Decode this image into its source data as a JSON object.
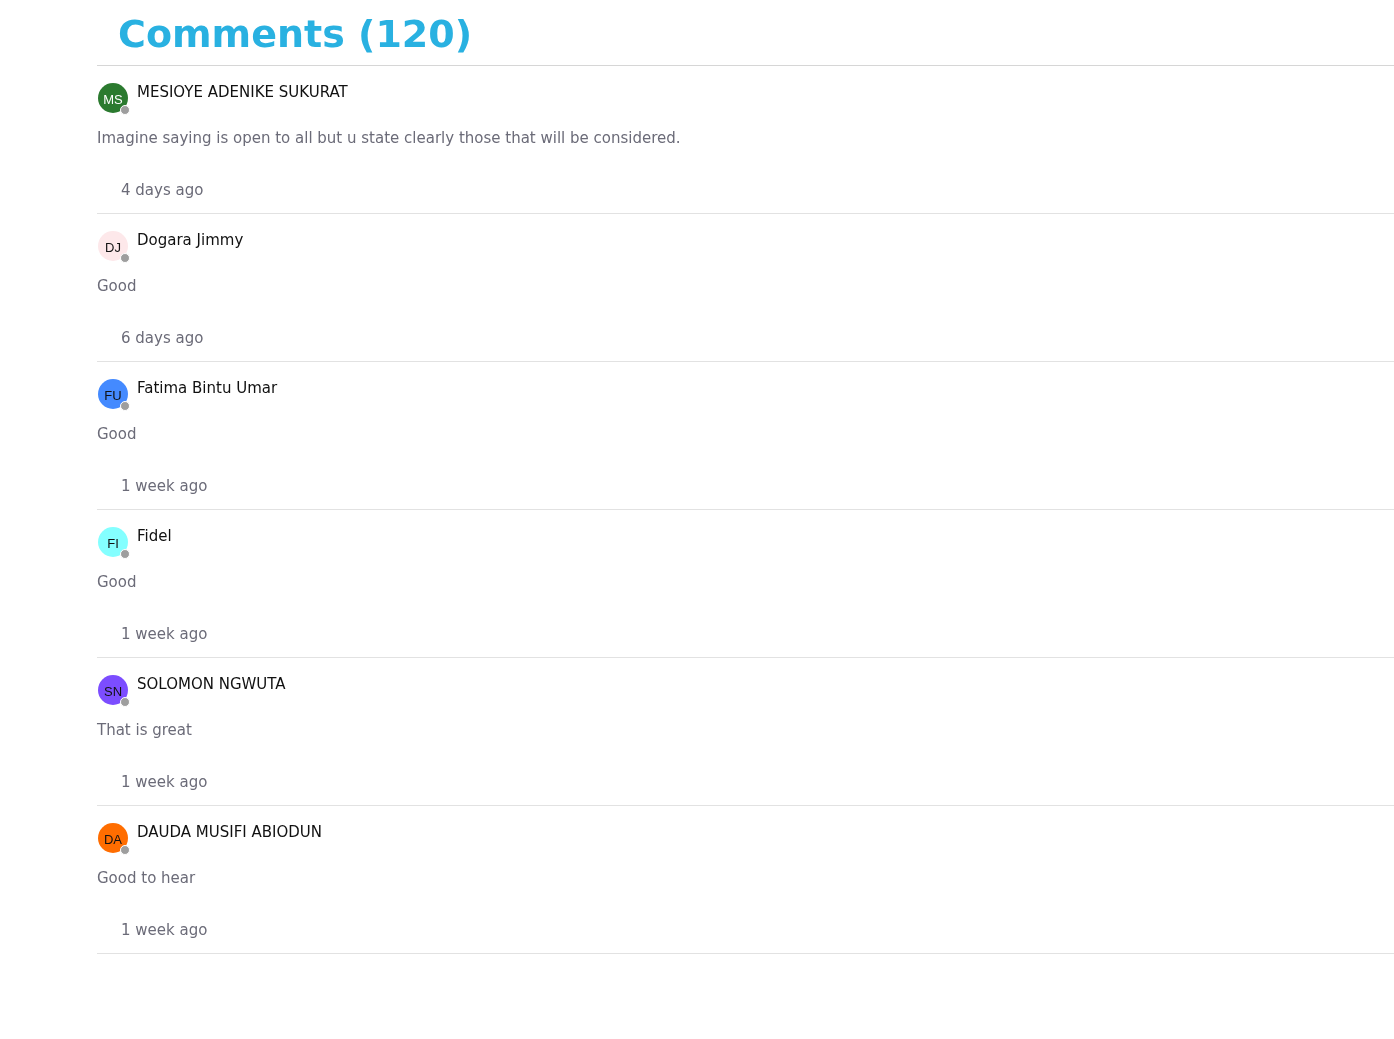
{
  "heading": "Comments (120)",
  "comments": [
    {
      "initials": "MS",
      "color": "#2b7a2f",
      "author": "MESIOYE ADENIKE SUKURAT",
      "text": "Imagine saying is open to all but u state clearly those that will be considered.",
      "time": "4 days ago"
    },
    {
      "initials": "DJ",
      "color": "#fde8ea",
      "author": "Dogara Jimmy",
      "text": "Good",
      "time": "6 days ago"
    },
    {
      "initials": "FU",
      "color": "#448aff",
      "author": "Fatima Bintu Umar",
      "text": "Good",
      "time": "1 week ago"
    },
    {
      "initials": "FI",
      "color": "#84ffff",
      "author": "Fidel",
      "text": "Good",
      "time": "1 week ago"
    },
    {
      "initials": "SN",
      "color": "#7c4dff",
      "author": "SOLOMON NGWUTA",
      "text": "That is great",
      "time": "1 week ago"
    },
    {
      "initials": "DA",
      "color": "#ff6d00",
      "author": "DAUDA MUSIFI ABIODUN",
      "text": "Good to hear",
      "time": "1 week ago"
    }
  ]
}
